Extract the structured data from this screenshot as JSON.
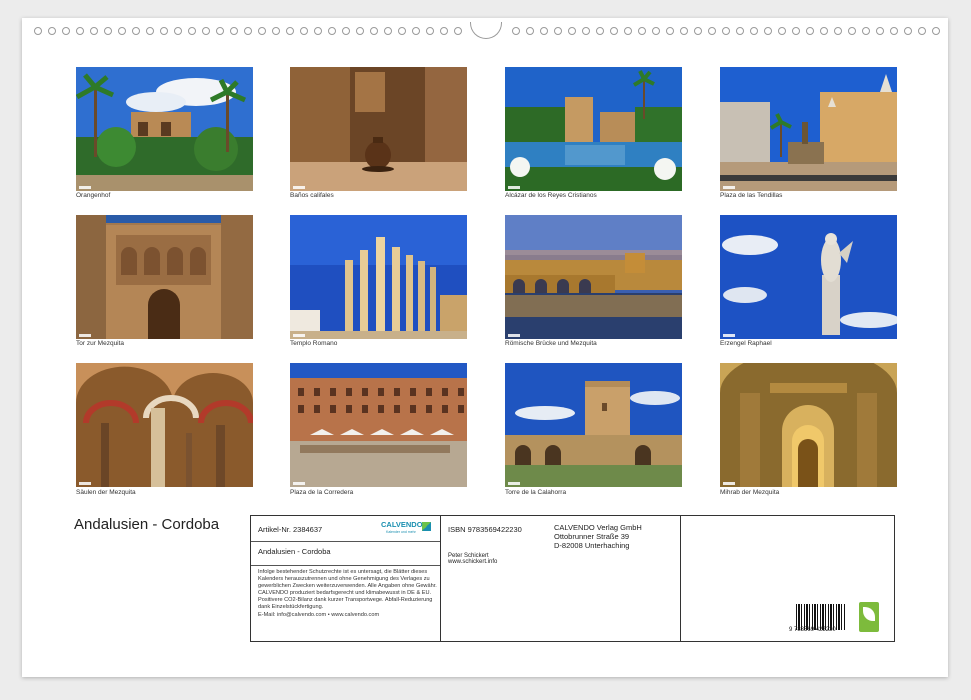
{
  "calendar": {
    "title": "Andalusien - Cordoba",
    "photos": [
      {
        "caption": "Orangenhof"
      },
      {
        "caption": "Baños califales"
      },
      {
        "caption": "Alcázar de los Reyes Cristianos"
      },
      {
        "caption": "Plaza de las Tendillas"
      },
      {
        "caption": "Tor zur Mezquita"
      },
      {
        "caption": "Templo Romano"
      },
      {
        "caption": "Römische Brücke und Mezquita"
      },
      {
        "caption": "Erzengel Raphael"
      },
      {
        "caption": "Säulen der Mezquita"
      },
      {
        "caption": "Plaza de la Corredera"
      },
      {
        "caption": "Torre de la Calahorra"
      },
      {
        "caption": "Mihrab der Mezquita"
      }
    ]
  },
  "info": {
    "article": "Artikel-Nr. 2384637",
    "product_title": "Andalusien - Cordoba",
    "logo": "CALVENDO",
    "logo_tagline": "Kalender und mehr",
    "legal": "Infolge bestehender Schutzrechte ist es untersagt, die Blätter dieses Kalenders herauszutrennen und ohne Genehmigung des Verlages zu gewerblichen Zwecken weiterzuverwenden. Alle Angaben ohne Gewähr. CALVENDO produziert bedarfsgerecht und klimabewusst in DE & EU. Positivere CO2-Bilanz dank kurzer Transportwege. Abfall-Reduzierung dank Einzelstückfertigung.",
    "email": "E-Mail: info@calvendo.com • www.calvendo.com",
    "isbn": "ISBN 9783569422230",
    "author": "Peter Schickert",
    "author_web": "www.schickert.info",
    "publisher_name": "CALVENDO Verlag GmbH",
    "publisher_street": "Ottobrunner Straße 39",
    "publisher_city": "D-82008 Unterhaching",
    "barcode_number": "9 783569 422230",
    "eco_label": "feco"
  },
  "colors": {
    "page_bg": "#ffffff",
    "frame": "#333333",
    "calvendo_blue": "#1a8fb0",
    "eco_green": "#7dbb3c"
  }
}
